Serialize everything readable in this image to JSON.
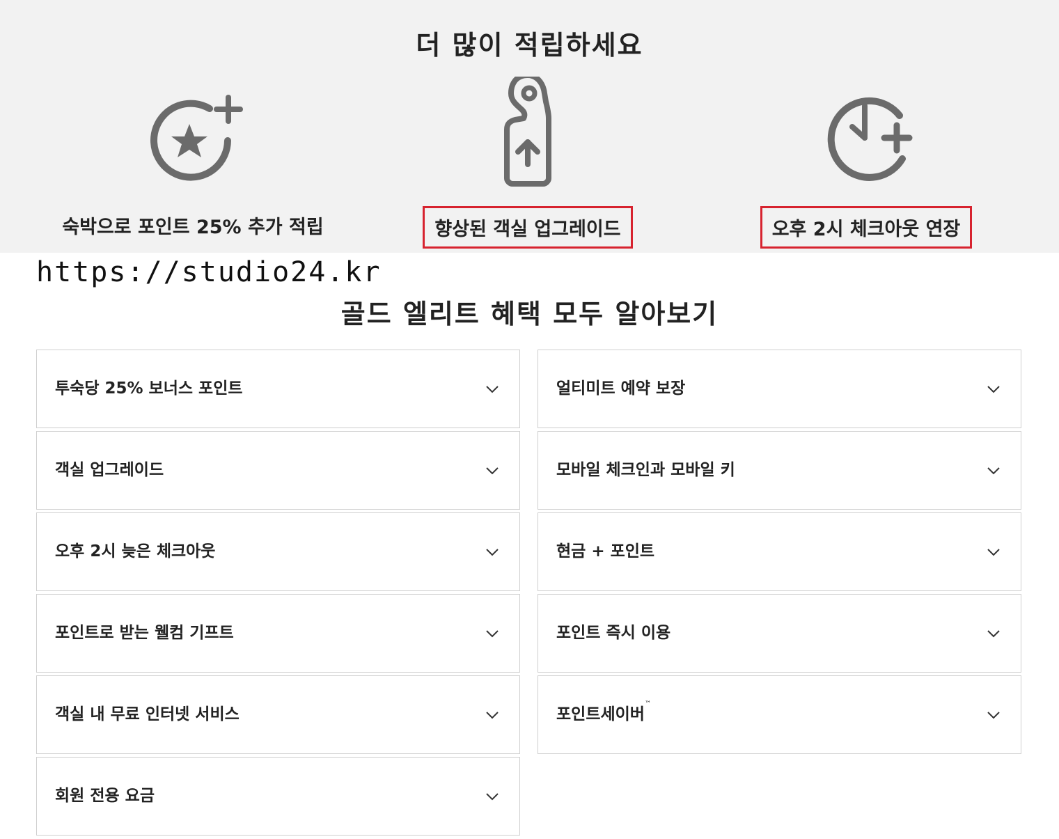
{
  "earn_more": {
    "title": "더 많이 적립하세요",
    "features": [
      {
        "icon": "star-plus-icon",
        "label": "숙박으로 포인트 25% 추가 적립"
      },
      {
        "icon": "door-hanger-upgrade-icon",
        "label": "향상된 객실 업그레이드"
      },
      {
        "icon": "clock-plus-icon",
        "label": "오후 2시 체크아웃 연장"
      }
    ]
  },
  "watermark": "https://studio24.kr",
  "benefits": {
    "title": "골드 엘리트 혜택 모두 알아보기",
    "left": [
      "투숙당 25% 보너스 포인트",
      "객실 업그레이드",
      "오후 2시 늦은 체크아웃",
      "포인트로 받는 웰컴 기프트",
      "객실 내 무료 인터넷 서비스",
      "회원 전용 요금"
    ],
    "right": [
      "얼티미트 예약 보장",
      "모바일 체크인과 모바일 키",
      "현금 + 포인트",
      "포인트 즉시 이용",
      "포인트세이버",
      ""
    ],
    "right_sup": [
      "",
      "",
      "",
      "",
      "™",
      ""
    ]
  },
  "colors": {
    "band_bg": "#f2f2f2",
    "highlight_box": "#d7232f",
    "icon_gray": "#6b6b6b",
    "border": "#cfcfcf"
  }
}
